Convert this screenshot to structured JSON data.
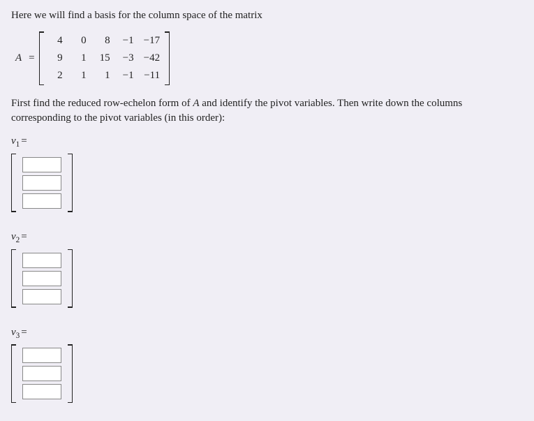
{
  "intro": "Here we will find a basis for the column space of the matrix",
  "matrix_label": "A",
  "equals": "=",
  "matrix": {
    "rows": [
      [
        "4",
        "0",
        "8",
        "−1",
        "−17"
      ],
      [
        "9",
        "1",
        "15",
        "−3",
        "−42"
      ],
      [
        "2",
        "1",
        "1",
        "−1",
        "−11"
      ]
    ]
  },
  "instruction_part1": "First find the reduced row-echelon form of ",
  "instruction_A": "A",
  "instruction_part2": " and identify the pivot variables. Then write down the columns corresponding to the pivot variables (in this order):",
  "vectors": [
    {
      "label": "v",
      "sub": "1",
      "inputs": [
        "",
        "",
        ""
      ]
    },
    {
      "label": "v",
      "sub": "2",
      "inputs": [
        "",
        "",
        ""
      ]
    },
    {
      "label": "v",
      "sub": "3",
      "inputs": [
        "",
        "",
        ""
      ]
    }
  ]
}
